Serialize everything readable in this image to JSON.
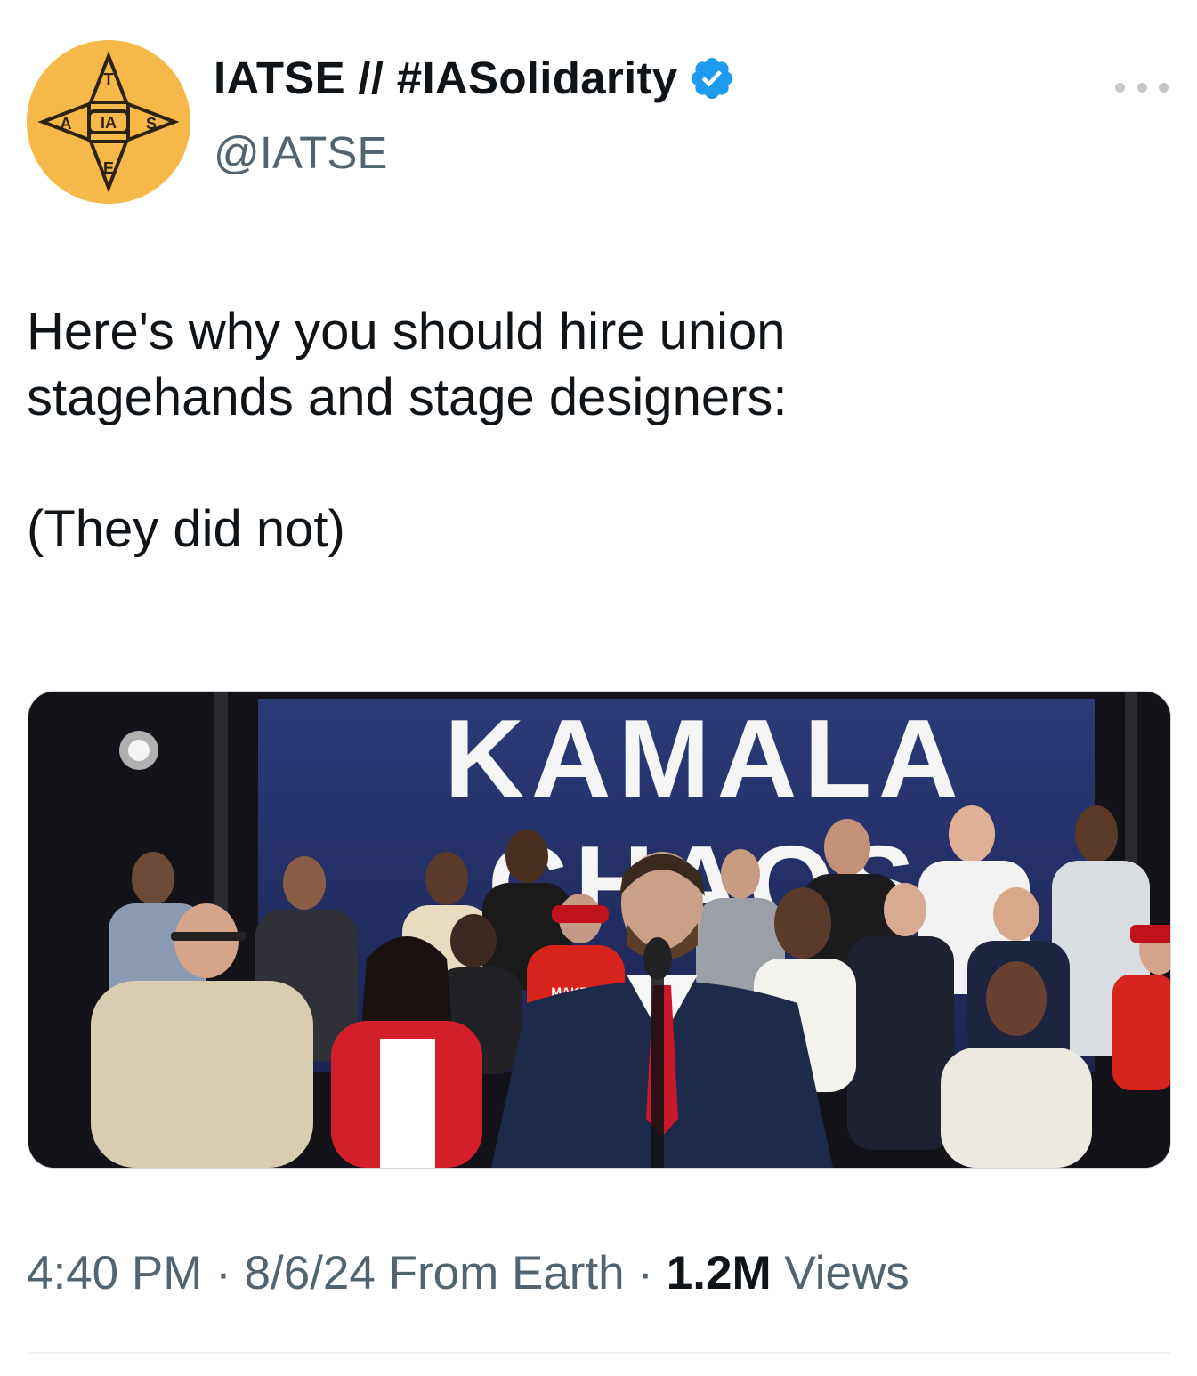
{
  "author": {
    "display_name": "IATSE // #IASolidarity",
    "handle": "@IATSE",
    "verified_icon": "verified-badge-icon",
    "avatar_logo_text": "IA",
    "colors": {
      "avatar_bg": "#f7b84a",
      "verified": "#1d9bf0"
    }
  },
  "tweet": {
    "lines": [
      "Here's why you should hire union",
      "stagehands and stage designers:",
      "(They did not)"
    ]
  },
  "media": {
    "banner_text": "KAMALA",
    "banner_partial_text": "CHAOS",
    "hat_text": "MAKE"
  },
  "meta": {
    "time": "4:40 PM",
    "separator": "·",
    "date_source": "8/6/24 From Earth",
    "views_count": "1.2M",
    "views_label": "Views"
  },
  "icons": {
    "more": "more-options-icon"
  }
}
